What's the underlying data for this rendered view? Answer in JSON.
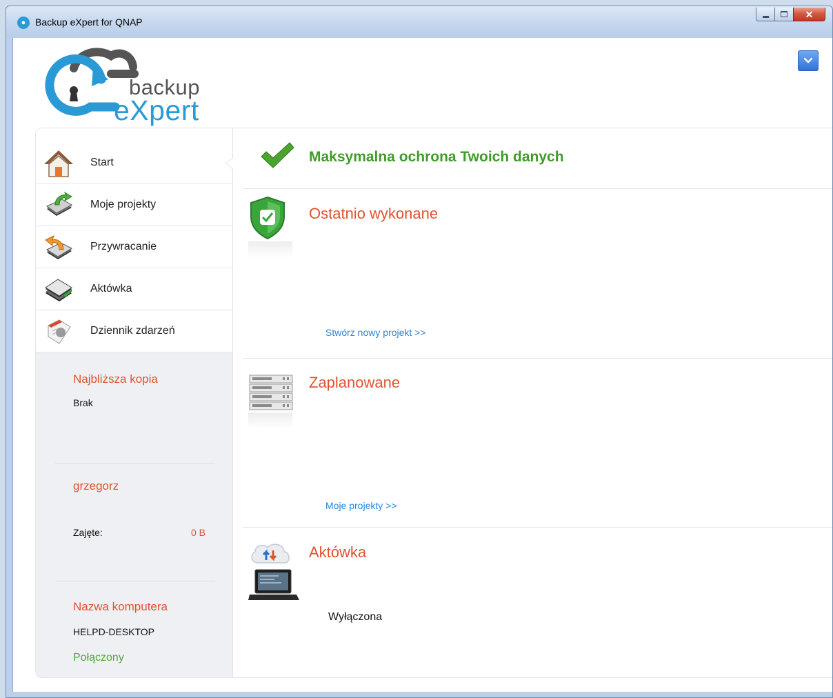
{
  "window": {
    "title": "Backup eXpert for QNAP",
    "controls": [
      "minimize",
      "maximize",
      "close"
    ]
  },
  "header": {
    "logo_text_1": "backup",
    "logo_text_2": "eXpert",
    "menu_icon": "chevron-down-icon"
  },
  "sidebar": {
    "items": [
      {
        "label": "Start",
        "icon": "home-icon",
        "active": true
      },
      {
        "label": "Moje projekty",
        "icon": "projects-icon"
      },
      {
        "label": "Przywracanie",
        "icon": "restore-icon"
      },
      {
        "label": "Aktówka",
        "icon": "briefcase-icon"
      },
      {
        "label": "Dziennik zdarzeń",
        "icon": "event-log-icon"
      }
    ],
    "next_backup": {
      "title": "Najbliższa kopia",
      "value": "Brak"
    },
    "user": {
      "name": "grzegorz",
      "used_label": "Zajęte:",
      "used_value": "0 B"
    },
    "computer": {
      "title": "Nazwa komputera",
      "name": "HELPD-DESKTOP",
      "status": "Połączony"
    }
  },
  "content": {
    "headline": "Maksymalna ochrona Twoich danych",
    "sections": [
      {
        "title": "Ostatnio wykonane",
        "icon": "shield-check-icon",
        "link": "Stwórz nowy projekt >>"
      },
      {
        "title": "Zaplanowane",
        "icon": "server-stack-icon",
        "link": "Moje projekty >>"
      },
      {
        "title": "Aktówka",
        "icon": "cloud-laptop-icon",
        "status": "Wyłączona"
      }
    ]
  },
  "colors": {
    "accent_orange": "#e0522f",
    "accent_green": "#3f9c28",
    "link_blue": "#2a86d8",
    "brand_blue": "#2a9ad6"
  }
}
